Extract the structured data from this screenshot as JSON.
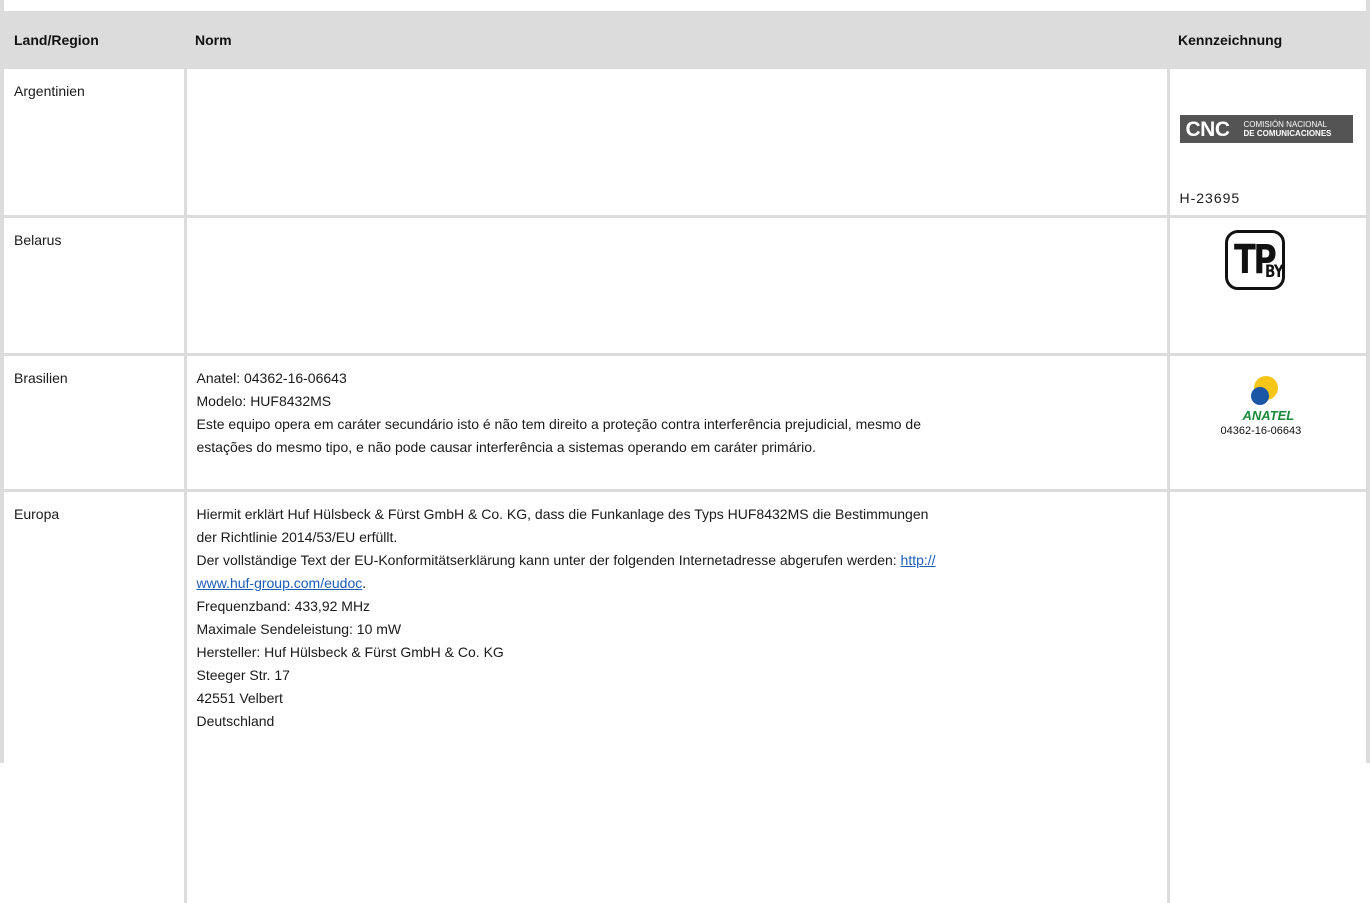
{
  "table": {
    "headers": [
      "Land/Region",
      "Norm",
      "Kennzeichnung"
    ],
    "rows": [
      {
        "country": "Argentinien",
        "norm": [],
        "mark": {
          "logo_letters": "CNC",
          "logo_text_line1": "COMISIÓN NACIONAL",
          "logo_text_line2": "DE COMUNICACIONES",
          "code": "H-23695"
        }
      },
      {
        "country": "Belarus",
        "norm": [],
        "mark": {
          "logo_main": "TP",
          "logo_sub": "BY"
        }
      },
      {
        "country": "Brasilien",
        "norm": [
          "Anatel: 04362-16-06643",
          "Modelo: HUF8432MS",
          "Este equipo opera em caráter secundário isto é não tem direito a proteção contra interferência prejudicial, mesmo de",
          "estações do mesmo tipo, e não pode causar interferência a sistemas operando em caráter primário."
        ],
        "mark": {
          "logo_word": "ANATEL",
          "code": "04362-16-06643"
        }
      },
      {
        "country": "Europa",
        "norm": [
          "Hiermit erklärt Huf Hülsbeck & Fürst GmbH & Co. KG, dass die Funkanlage des Typs HUF8432MS die Bestimmungen",
          "der Richtlinie 2014/53/EU erfüllt.",
          "Der vollständige Text der EU-Konformitätserklärung kann unter der folgenden Internetadresse abgerufen werden: ",
          "Frequenzband: 433,92 MHz",
          "Maximale Sendeleistung: 10 mW",
          "Hersteller: Huf Hülsbeck & Fürst GmbH & Co. KG",
          "Steeger Str. 17",
          "42551 Velbert",
          "Deutschland"
        ],
        "link_part1": "http://",
        "link_part2": "www.huf-group.com/eudoc",
        "link_suffix": ".",
        "mark": {}
      }
    ]
  },
  "colors": {
    "border": "#dcdcdc",
    "header_bg": "#dcdcdc",
    "link": "#1c5db7",
    "anatel_green": "#1a8a3a",
    "anatel_blue": "#1b56a6",
    "anatel_yellow": "#f5c518"
  }
}
